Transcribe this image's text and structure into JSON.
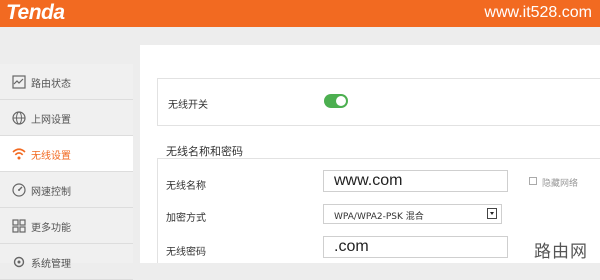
{
  "header": {
    "logo_text": "Tenda",
    "watermark": "www.it528.com"
  },
  "sidebar": {
    "items": [
      {
        "label": "路由状态",
        "icon": "status-chart-icon"
      },
      {
        "label": "上网设置",
        "icon": "globe-icon"
      },
      {
        "label": "无线设置",
        "icon": "wifi-icon",
        "active": true
      },
      {
        "label": "网速控制",
        "icon": "speedometer-icon"
      },
      {
        "label": "更多功能",
        "icon": "grid-icon"
      },
      {
        "label": "系统管理",
        "icon": "gear-icon"
      }
    ]
  },
  "wireless_switch": {
    "label": "无线开关",
    "enabled": true
  },
  "name_password_section": {
    "title": "无线名称和密码",
    "ssid_label": "无线名称",
    "ssid_value": "www.com",
    "hide_network_label": "隐藏网络",
    "encryption_label": "加密方式",
    "encryption_value": "WPA/WPA2-PSK 混合",
    "password_label": "无线密码",
    "password_value": ".com"
  },
  "corner_watermark": "路由网",
  "colors": {
    "brand": "#f26a21",
    "toggle_on": "#4caf50"
  }
}
